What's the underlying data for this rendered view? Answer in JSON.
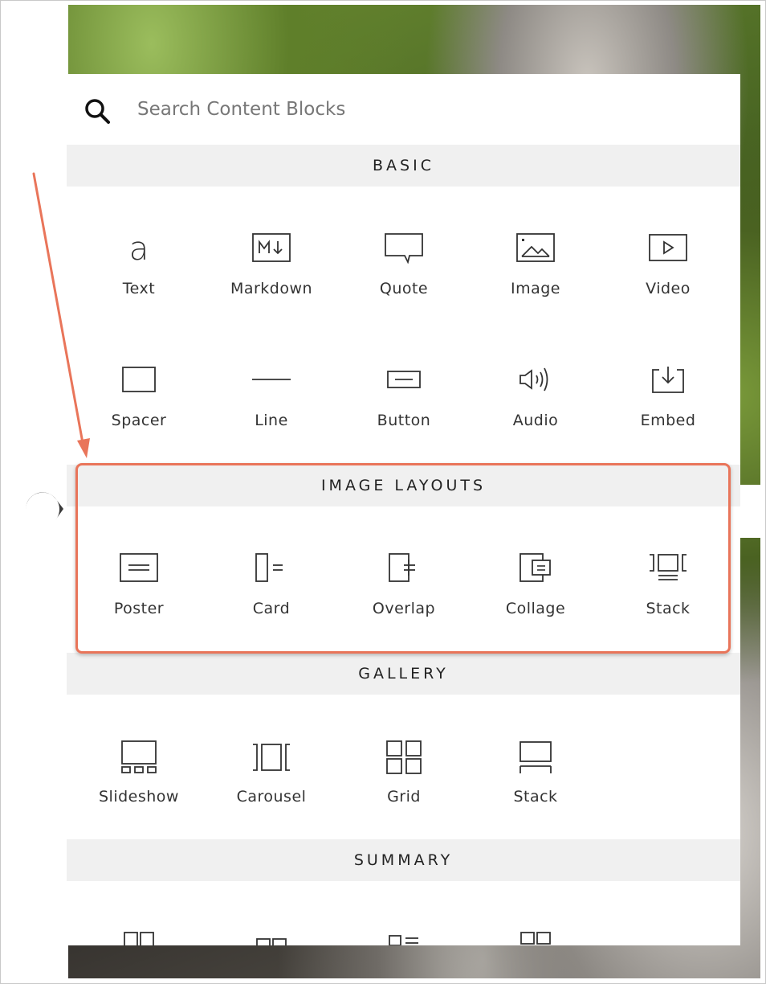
{
  "search": {
    "placeholder": "Search Content Blocks",
    "icon": "search-icon"
  },
  "sections": {
    "basic": {
      "title": "BASIC",
      "items": [
        {
          "label": "Text",
          "icon": "text-icon"
        },
        {
          "label": "Markdown",
          "icon": "markdown-icon"
        },
        {
          "label": "Quote",
          "icon": "quote-icon"
        },
        {
          "label": "Image",
          "icon": "image-icon"
        },
        {
          "label": "Video",
          "icon": "video-icon"
        },
        {
          "label": "Spacer",
          "icon": "spacer-icon"
        },
        {
          "label": "Line",
          "icon": "line-icon"
        },
        {
          "label": "Button",
          "icon": "button-icon"
        },
        {
          "label": "Audio",
          "icon": "audio-icon"
        },
        {
          "label": "Embed",
          "icon": "embed-icon"
        }
      ]
    },
    "image_layouts": {
      "title": "IMAGE LAYOUTS",
      "items": [
        {
          "label": "Poster",
          "icon": "poster-icon"
        },
        {
          "label": "Card",
          "icon": "card-icon"
        },
        {
          "label": "Overlap",
          "icon": "overlap-icon"
        },
        {
          "label": "Collage",
          "icon": "collage-icon"
        },
        {
          "label": "Stack",
          "icon": "stack-icon"
        }
      ]
    },
    "gallery": {
      "title": "GALLERY",
      "items": [
        {
          "label": "Slideshow",
          "icon": "slideshow-icon"
        },
        {
          "label": "Carousel",
          "icon": "carousel-icon"
        },
        {
          "label": "Grid",
          "icon": "grid-icon"
        },
        {
          "label": "Stack",
          "icon": "gallery-stack-icon"
        }
      ]
    },
    "summary": {
      "title": "SUMMARY",
      "items": [
        {
          "icon": "summary-wall-icon"
        },
        {
          "icon": "summary-carousel-icon"
        },
        {
          "icon": "summary-list-icon"
        },
        {
          "icon": "summary-grid-icon"
        }
      ]
    }
  },
  "colors": {
    "highlight": "#e9755a",
    "section_bg": "#f0f0f0",
    "icon_stroke": "#333333",
    "marker": "#3a3a3a"
  }
}
